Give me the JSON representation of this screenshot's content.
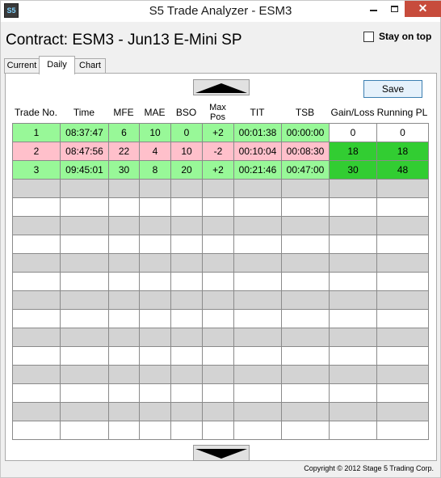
{
  "window": {
    "icon_text": "S5",
    "title": "S5 Trade Analyzer - ESM3"
  },
  "header": {
    "contract_title": "Contract: ESM3 - Jun13 E-Mini SP",
    "stay_on_top_label": "Stay on top",
    "stay_on_top_checked": false
  },
  "tabs": [
    {
      "label": "Current",
      "active": false
    },
    {
      "label": "Daily",
      "active": true
    },
    {
      "label": "Chart",
      "active": false
    }
  ],
  "toolbar": {
    "save_label": "Save"
  },
  "table": {
    "columns": [
      "Trade No.",
      "Time",
      "MFE",
      "MAE",
      "BSO",
      "Max Pos",
      "TIT",
      "TSB",
      "Gain/Loss",
      "Running PL"
    ],
    "columns_display": {
      "max_pos_line1": "Max",
      "max_pos_line2": "Pos"
    },
    "rows": [
      {
        "trade_no": "1",
        "time": "08:37:47",
        "mfe": "6",
        "mae": "10",
        "bso": "0",
        "max_pos": "+2",
        "tit": "00:01:38",
        "tsb": "00:00:00",
        "gain_loss": "0",
        "running_pl": "0",
        "result": "win"
      },
      {
        "trade_no": "2",
        "time": "08:47:56",
        "mfe": "22",
        "mae": "4",
        "bso": "10",
        "max_pos": "-2",
        "tit": "00:10:04",
        "tsb": "00:08:30",
        "gain_loss": "18",
        "running_pl": "18",
        "result": "loss"
      },
      {
        "trade_no": "3",
        "time": "09:45:01",
        "mfe": "30",
        "mae": "8",
        "bso": "20",
        "max_pos": "+2",
        "tit": "00:21:46",
        "tsb": "00:47:00",
        "gain_loss": "30",
        "running_pl": "48",
        "result": "win"
      }
    ],
    "empty_row_count": 14
  },
  "colors": {
    "win_row": "#98f898",
    "loss_row": "#ffc0cb",
    "empty_row_alt": "#d3d3d3",
    "gain_positive": "#32cd32",
    "close_button": "#c74c3c"
  },
  "footer": {
    "copyright": "Copyright © 2012 Stage 5 Trading Corp."
  },
  "icons": [
    "app-icon",
    "minimize-icon",
    "maximize-icon",
    "close-icon",
    "scroll-up-arrow-icon",
    "scroll-down-arrow-icon"
  ]
}
